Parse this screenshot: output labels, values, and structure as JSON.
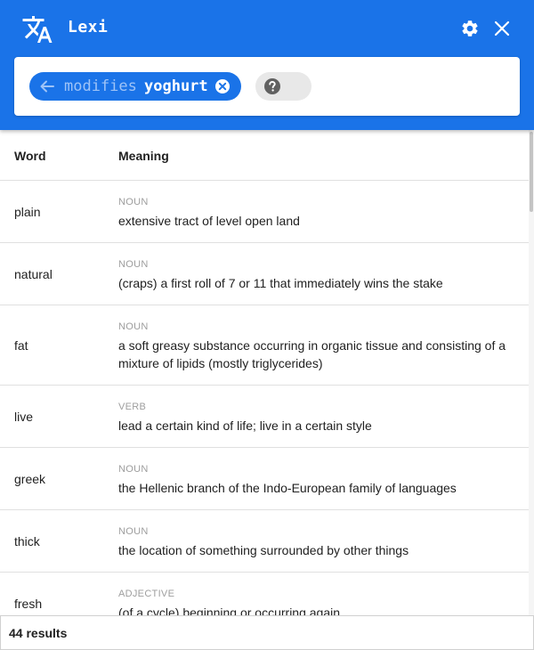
{
  "app": {
    "title": "Lexi"
  },
  "colors": {
    "primary": "#1a73e8",
    "chip_relation": "#9ec3f7",
    "help_chip": "#e8e8e8",
    "muted": "#9e9e9e"
  },
  "icons": {
    "translate": "translate-icon",
    "settings": "gear-icon",
    "close": "close-icon",
    "back": "arrow-left-icon",
    "clear": "clear-circle-icon",
    "help": "help-circle-icon"
  },
  "query": {
    "relation": "modifies",
    "word": "yoghurt"
  },
  "table": {
    "headers": {
      "word": "Word",
      "meaning": "Meaning"
    },
    "rows": [
      {
        "word": "plain",
        "pos": "NOUN",
        "definition": "extensive tract of level open land"
      },
      {
        "word": "natural",
        "pos": "NOUN",
        "definition": "(craps) a first roll of 7 or 11 that immediately wins the stake"
      },
      {
        "word": "fat",
        "pos": "NOUN",
        "definition": "a soft greasy substance occurring in organic tissue and consisting of a mixture of lipids (mostly triglycerides)"
      },
      {
        "word": "live",
        "pos": "VERB",
        "definition": "lead a certain kind of life; live in a certain style"
      },
      {
        "word": "greek",
        "pos": "NOUN",
        "definition": "the Hellenic branch of the Indo-European family of languages"
      },
      {
        "word": "thick",
        "pos": "NOUN",
        "definition": "the location of something surrounded by other things"
      },
      {
        "word": "fresh",
        "pos": "ADJECTIVE",
        "definition": "(of a cycle) beginning or occurring again"
      }
    ]
  },
  "footer": {
    "results": "44 results"
  }
}
